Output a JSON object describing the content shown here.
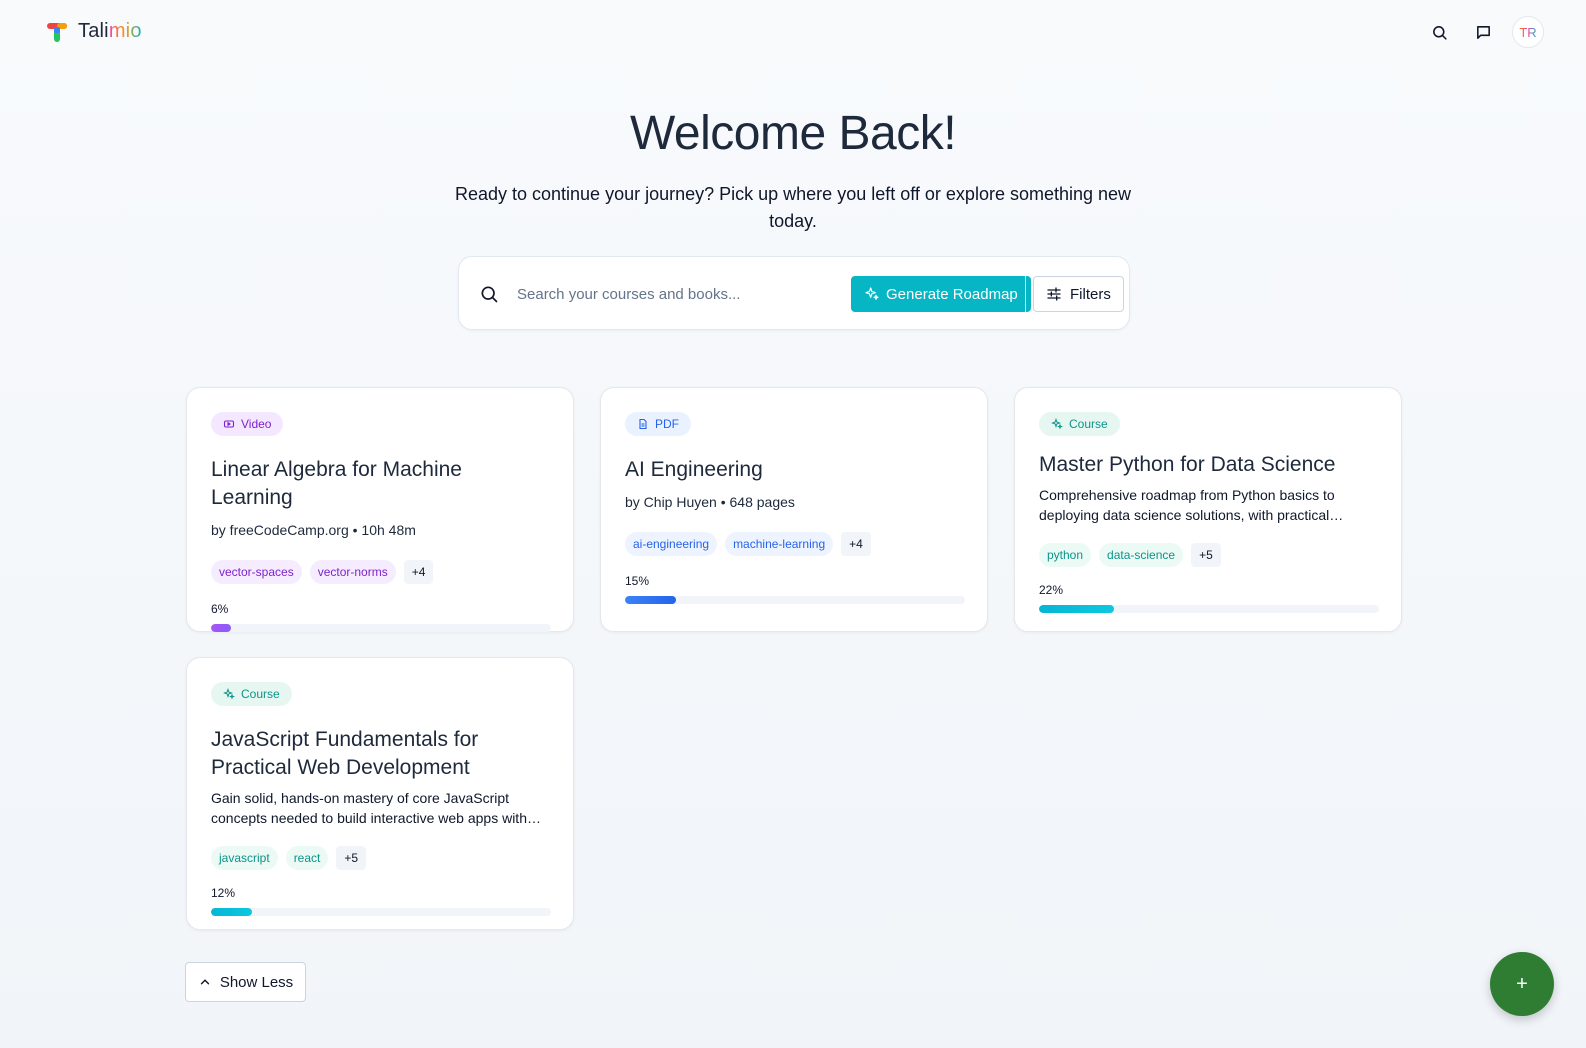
{
  "app": {
    "name_prefix": "Tali",
    "name_accent": "mio"
  },
  "header": {
    "icons": [
      "search-icon",
      "chat-icon"
    ],
    "avatar_initials": "TR"
  },
  "hero": {
    "title": "Welcome Back!",
    "subtitle": "Ready to continue your journey? Pick up where you left off or explore something new today."
  },
  "search": {
    "placeholder": "Search your courses and books...",
    "value": "",
    "generate_label": "Generate Roadmap",
    "filters_label": "Filters"
  },
  "cards": [
    {
      "type": "Video",
      "title": "Linear Algebra for Machine Learning",
      "meta": "by freeCodeCamp.org • 10h 48m",
      "tags": [
        "vector-spaces",
        "vector-norms"
      ],
      "more": "+4",
      "progress_label": "6%",
      "progress": 6
    },
    {
      "type": "PDF",
      "title": "AI Engineering",
      "meta": "by Chip Huyen • 648 pages",
      "tags": [
        "ai-engineering",
        "machine-learning"
      ],
      "more": "+4",
      "progress_label": "15%",
      "progress": 15
    },
    {
      "type": "Course",
      "title": "Master Python for Data Science",
      "description": "Comprehensive roadmap from Python basics to deploying data science solutions, with practical…",
      "tags": [
        "python",
        "data-science"
      ],
      "more": "+5",
      "progress_label": "22%",
      "progress": 22
    },
    {
      "type": "Course",
      "title": "JavaScript Fundamentals for Practical Web Development",
      "description": "Gain solid, hands-on mastery of core JavaScript concepts needed to build interactive web apps with…",
      "tags": [
        "javascript",
        "react"
      ],
      "more": "+5",
      "progress_label": "12%",
      "progress": 12
    }
  ],
  "footer": {
    "show_less_label": "Show Less",
    "fab_label": "+"
  },
  "colors": {
    "primary": "#06b6c4",
    "fab": "#2e7d32",
    "video": "#7e22ce",
    "pdf": "#2563eb",
    "course": "#0d9488"
  }
}
